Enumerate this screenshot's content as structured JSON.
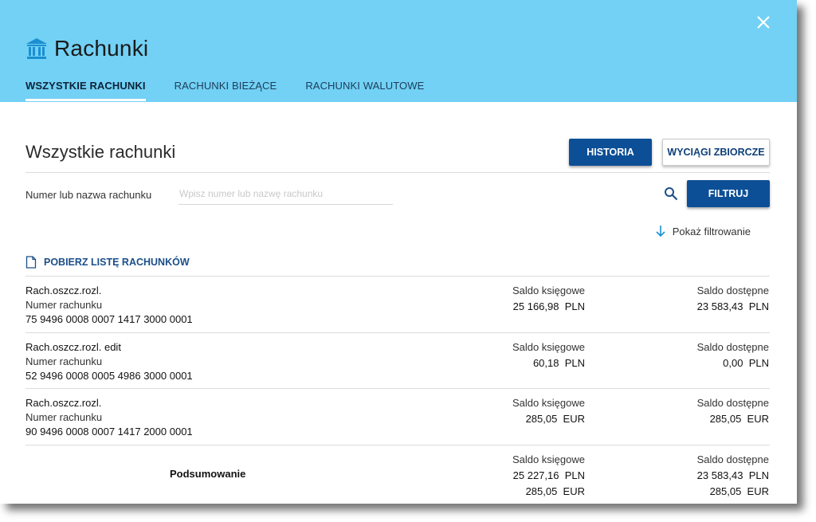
{
  "header": {
    "title": "Rachunki",
    "tabs": [
      {
        "label": "WSZYSTKIE RACHUNKI",
        "active": true
      },
      {
        "label": "RACHUNKI BIEŻĄCE",
        "active": false
      },
      {
        "label": "RACHUNKI WALUTOWE",
        "active": false
      }
    ]
  },
  "main": {
    "section_title": "Wszystkie rachunki",
    "history_button": "HISTORIA",
    "statements_button": "WYCIĄGI ZBIORCZE",
    "filter": {
      "label": "Numer lub nazwa rachunku",
      "placeholder": "Wpisz numer lub nazwę rachunku",
      "value": "",
      "filter_button": "FILTRUJ",
      "show_filtering": "Pokaż filtrowanie"
    },
    "download_link": "POBIERZ LISTĘ RACHUNKÓW",
    "accounts": [
      {
        "name": "Rach.oszcz.rozl.",
        "number_label": "Numer rachunku",
        "number": "75 9496 0008 0007 1417 3000 0001",
        "book_label": "Saldo księgowe",
        "book_value": "25 166,98  PLN",
        "avail_label": "Saldo dostępne",
        "avail_value": "23 583,43  PLN"
      },
      {
        "name": "Rach.oszcz.rozl. edit",
        "number_label": "Numer rachunku",
        "number": "52 9496 0008 0005 4986 3000 0001",
        "book_label": "Saldo księgowe",
        "book_value": "60,18  PLN",
        "avail_label": "Saldo dostępne",
        "avail_value": "0,00  PLN"
      },
      {
        "name": "Rach.oszcz.rozl.",
        "number_label": "Numer rachunku",
        "number": "90 9496 0008 0007 1417 2000 0001",
        "book_label": "Saldo księgowe",
        "book_value": "285,05  EUR",
        "avail_label": "Saldo dostępne",
        "avail_value": "285,05  EUR"
      }
    ],
    "summary": {
      "label": "Podsumowanie",
      "book_label": "Saldo księgowe",
      "book_values": [
        "25 227,16  PLN",
        "285,05  EUR"
      ],
      "avail_label": "Saldo dostępne",
      "avail_values": [
        "23 583,43  PLN",
        "285,05  EUR"
      ]
    }
  },
  "colors": {
    "header_bg": "#72d1f4",
    "primary_button": "#0d4f96",
    "link": "#1b4f8a"
  },
  "icons": {
    "title": "bank-icon",
    "close": "close-icon",
    "search": "search-icon",
    "filter_toggle": "arrow-down-icon",
    "download": "document-icon"
  }
}
